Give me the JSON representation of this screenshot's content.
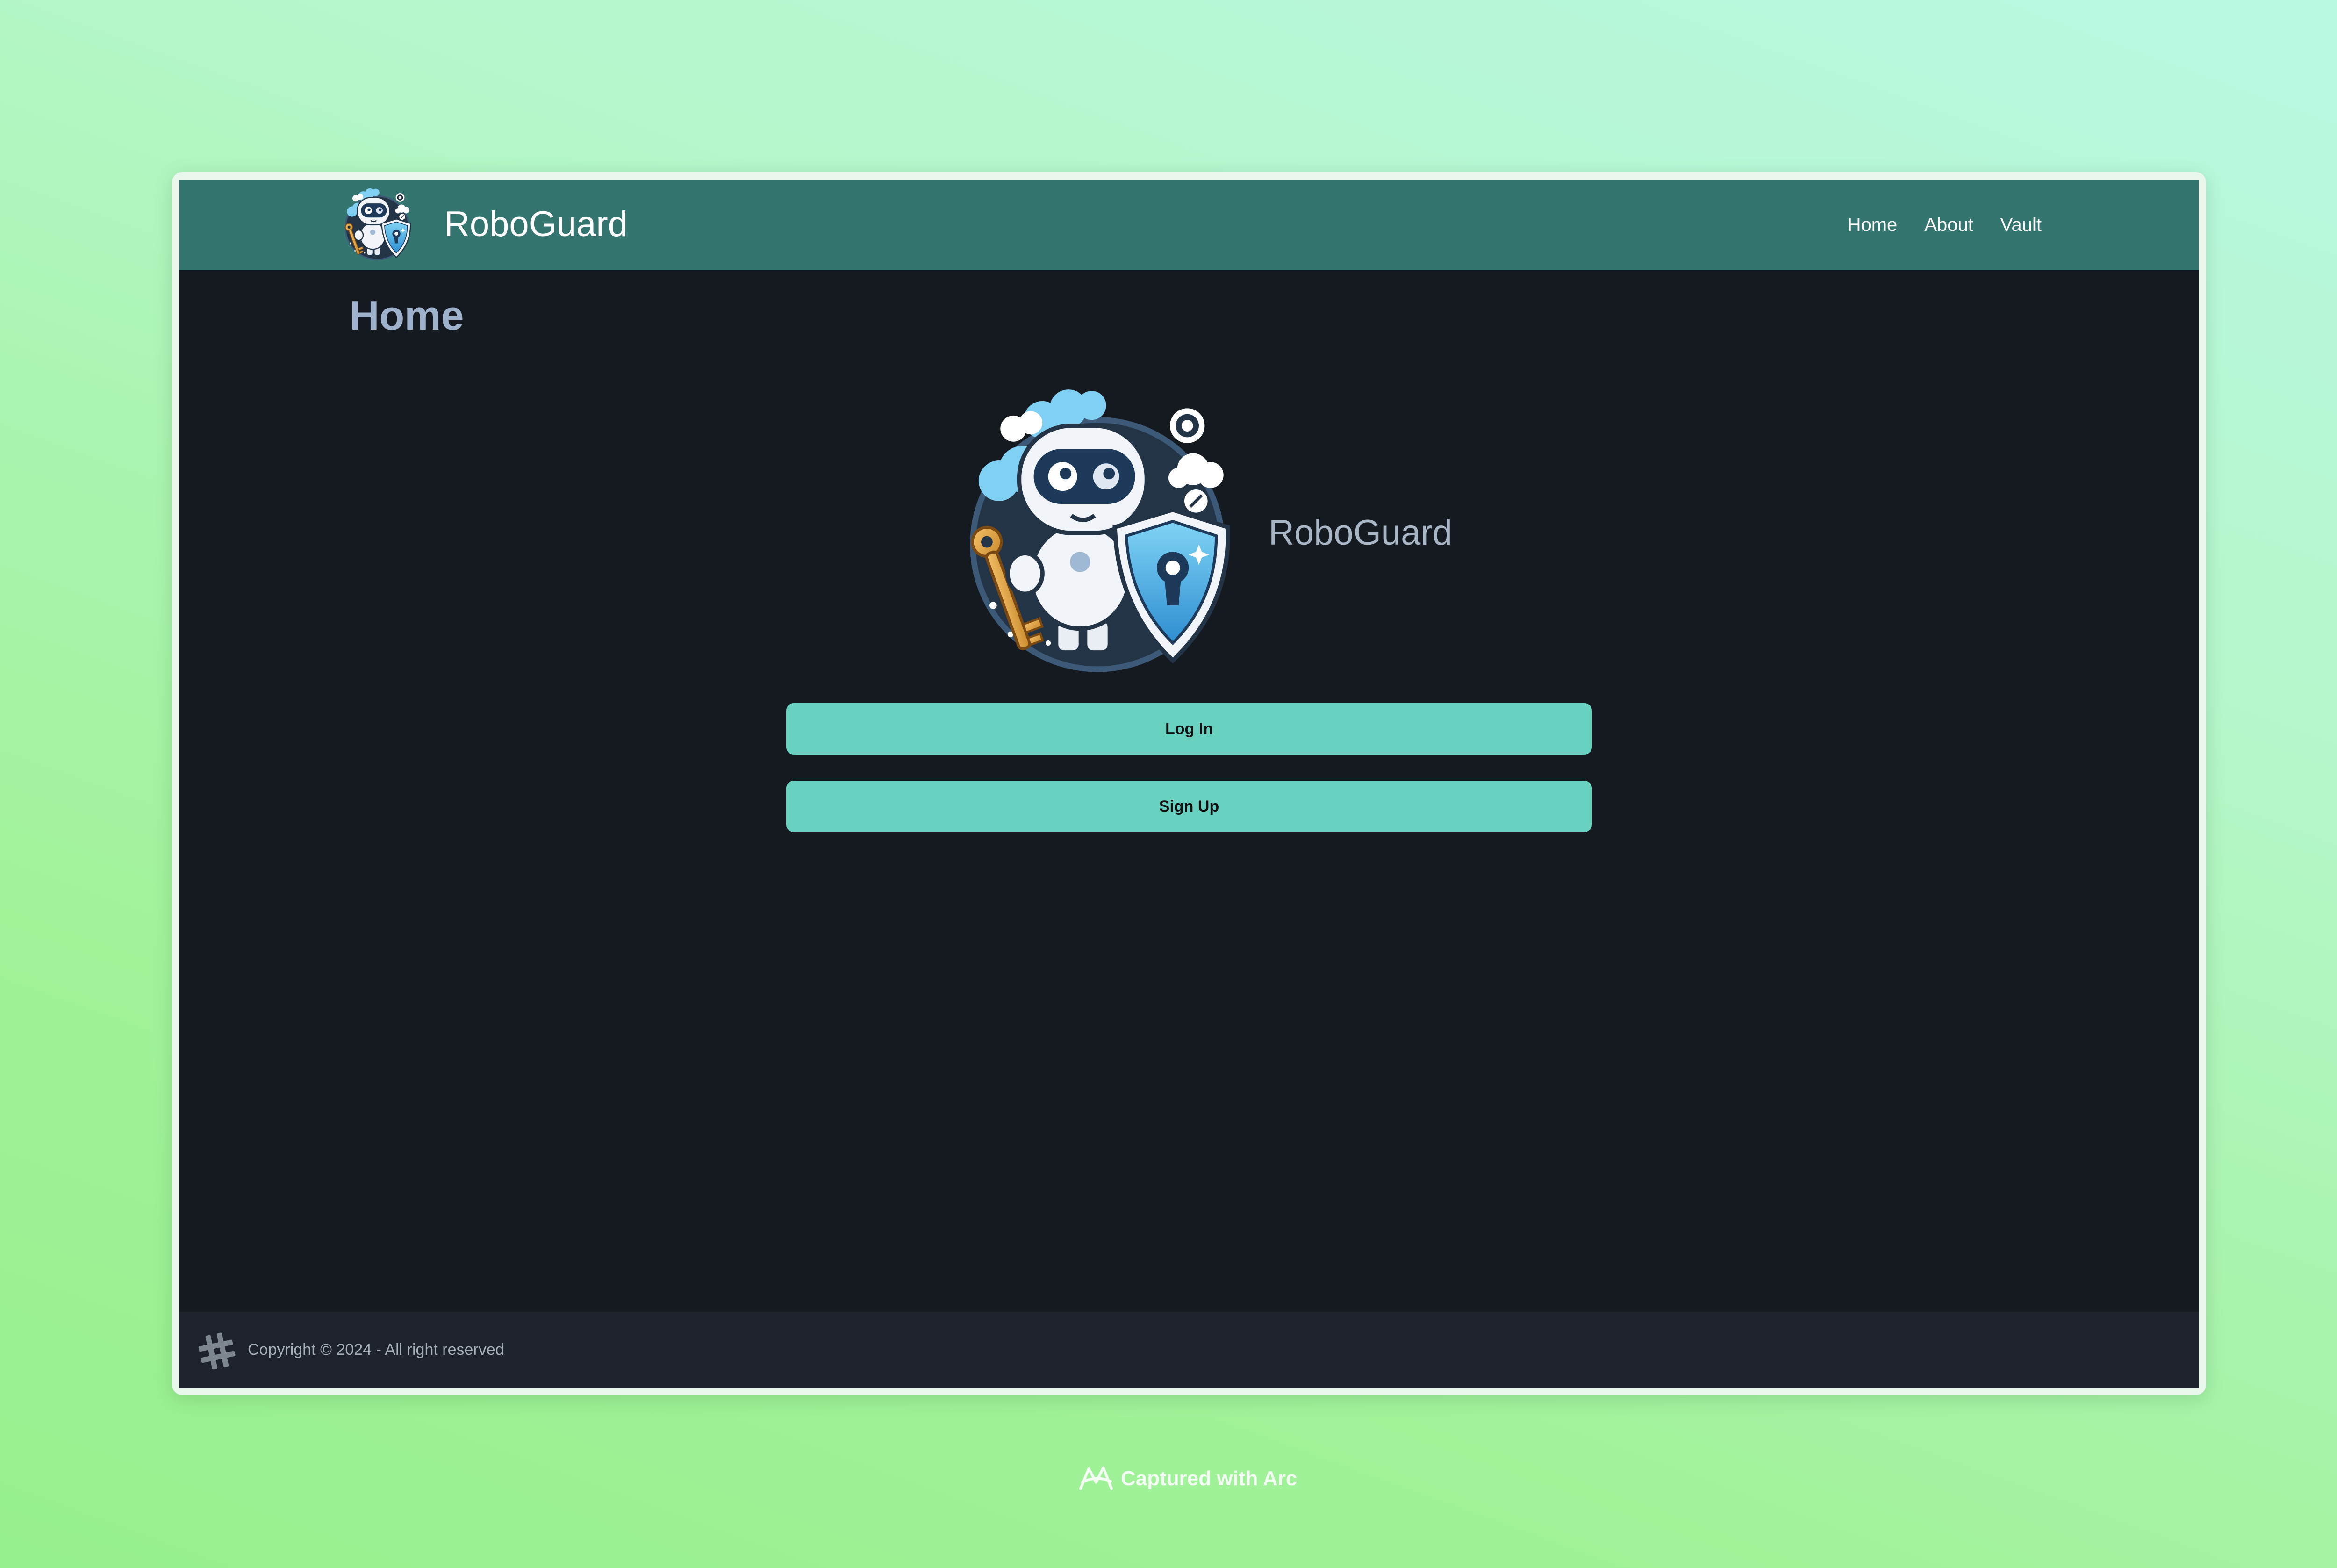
{
  "navbar": {
    "brand_name": "RoboGuard",
    "logo_icon": "robot-shield-logo",
    "links": [
      {
        "label": "Home"
      },
      {
        "label": "About"
      },
      {
        "label": "Vault"
      }
    ]
  },
  "main": {
    "page_title": "Home",
    "hero_logo_icon": "robot-shield-key-logo",
    "hero_name": "RoboGuard",
    "login_label": "Log In",
    "signup_label": "Sign Up"
  },
  "footer": {
    "icon": "hashtag-icon",
    "copyright": "Copyright © 2024 - All right reserved"
  },
  "watermark": {
    "icon": "arc-logo-icon",
    "text": "Captured with Arc"
  },
  "colors": {
    "navbar": "#35756f",
    "page_bg": "#151a21",
    "footer_bg": "#1e232b",
    "button": "#68d1bf",
    "heading": "#9fb2cc"
  }
}
